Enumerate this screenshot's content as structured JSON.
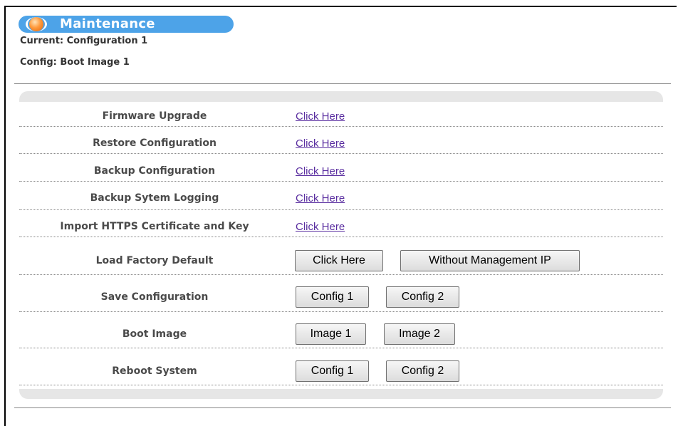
{
  "header": {
    "title": "Maintenance",
    "current": "Current: Configuration 1",
    "config": "Config: Boot Image 1"
  },
  "rows": [
    {
      "label": "Firmware Upgrade",
      "link": "Click Here"
    },
    {
      "label": "Restore Configuration",
      "link": "Click Here"
    },
    {
      "label": "Backup Configuration",
      "link": "Click Here"
    },
    {
      "label": "Backup Sytem Logging",
      "link": "Click Here"
    },
    {
      "label": "Import HTTPS Certificate and Key",
      "link": "Click Here"
    },
    {
      "label": "Load Factory Default",
      "buttons": [
        "Click Here",
        "Without Management IP"
      ]
    },
    {
      "label": "Save Configuration",
      "buttons": [
        "Config 1",
        "Config 2"
      ]
    },
    {
      "label": "Boot Image",
      "buttons": [
        "Image 1",
        "Image 2"
      ]
    },
    {
      "label": "Reboot System",
      "buttons": [
        "Config 1",
        "Config 2"
      ]
    }
  ],
  "colors": {
    "title_bar": "#4da3e8",
    "link": "#5a2ea0",
    "panel": "#e6e6e6"
  },
  "icons": {
    "title_orb": "orange-orb-icon"
  }
}
